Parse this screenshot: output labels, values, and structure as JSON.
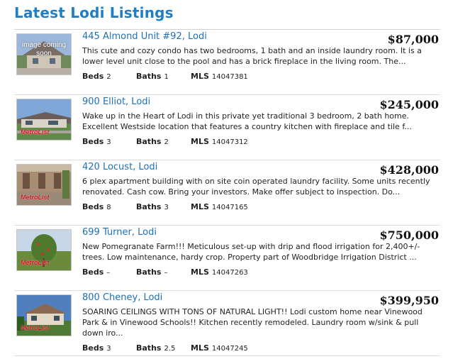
{
  "page_title": "Latest Lodi Listings",
  "labels": {
    "beds": "Beds",
    "baths": "Baths",
    "mls": "MLS"
  },
  "listings": [
    {
      "address": "445 Almond Unit #92, Lodi",
      "price": "$87,000",
      "description": "This cute and cozy condo has two bedrooms, 1 bath and an inside laundry room. It is a lower level unit close to the pool and has a brick fireplace in the living room. The...",
      "beds": "2",
      "baths": "1",
      "mls": "14047381",
      "thumbnail": {
        "kind": "placeholder",
        "text": "image coming soon"
      }
    },
    {
      "address": "900 Elliot, Lodi",
      "price": "$245,000",
      "description": "Wake up in the Heart of Lodi in this private yet traditional 3 bedroom, 2 bath home. Excellent Westside location that features a country kitchen with fireplace and tile f...",
      "beds": "3",
      "baths": "2",
      "mls": "14047312",
      "thumbnail": {
        "kind": "photo",
        "watermark": "MetroList"
      }
    },
    {
      "address": "420 Locust, Lodi",
      "price": "$428,000",
      "description": "6 plex apartment building with on site coin operated laundry facility. Some units recently renovated. Cash cow. Bring your investors. Make offer subject to inspection. Do...",
      "beds": "8",
      "baths": "3",
      "mls": "14047165",
      "thumbnail": {
        "kind": "photo",
        "watermark": "MetroList"
      }
    },
    {
      "address": "699 Turner, Lodi",
      "price": "$750,000",
      "description": "New Pomegranate Farm!!! Meticulous set-up with drip and flood irrigation for 2,400+/- trees. Low maintenance, hardy crop. Property part of Woodbridge Irrigation District ...",
      "beds": "–",
      "baths": "–",
      "mls": "14047263",
      "thumbnail": {
        "kind": "photo",
        "watermark": "MetroList"
      }
    },
    {
      "address": "800 Cheney, Lodi",
      "price": "$399,950",
      "description": "SOARING CEILINGS WITH TONS OF NATURAL LIGHT!! Lodi custom home near Vinewood Park & in Vinewood Schools!! Kitchen recently remodeled. Laundry room w/sink & pull down iro...",
      "beds": "3",
      "baths": "2.5",
      "mls": "14047245",
      "thumbnail": {
        "kind": "photo",
        "watermark": "MetroList"
      }
    }
  ]
}
